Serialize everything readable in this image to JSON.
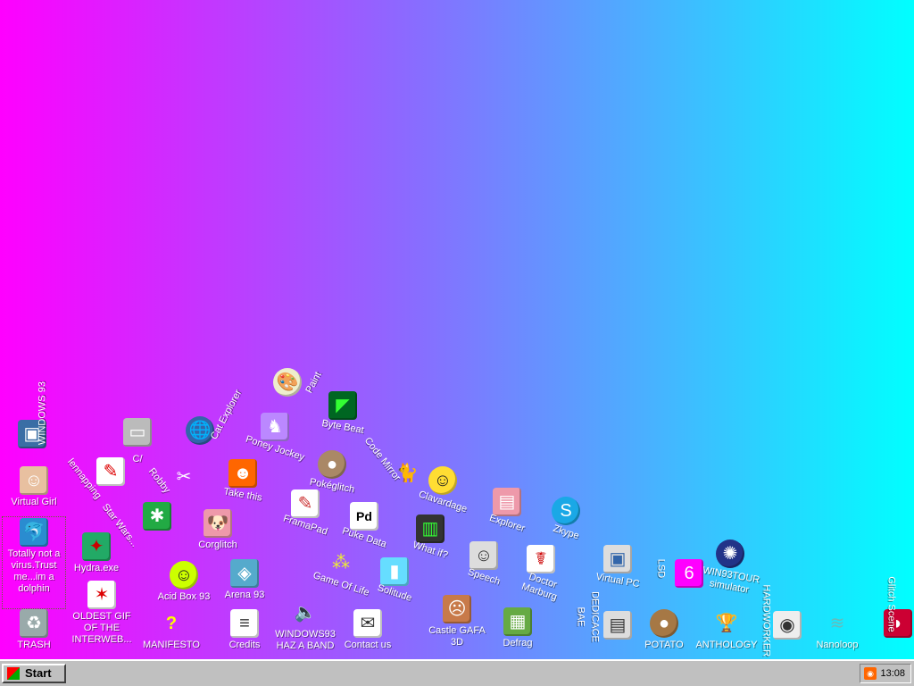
{
  "desktop": {
    "icons": {
      "windows93": "WINDOWS 93",
      "virtual_girl": "Virtual Girl",
      "dolphin": "Totally not a virus.Trust me...im a dolphin",
      "trash": "TRASH",
      "oldest_gif": "OLDEST GIF OF THE INTERWEB...",
      "manifesto": "MANIFESTO",
      "credits": "Credits",
      "windows93_band": "WINDOWS93 HAZ A BAND",
      "contact": "Contact us",
      "castle_gafa": "Castle GAFA 3D",
      "defrag": "Defrag",
      "potato": "POTATO",
      "anthology": "ANTHOLOGY",
      "nanoloop": "Nanoloop",
      "hydra": "Hydra.exe",
      "acid_box": "Acid Box 93",
      "arena": "Arena 93",
      "corglitch": "Corglitch",
      "star_wars": "Star Wars...",
      "lennapping": "lennapping",
      "c": "C/",
      "robby": "Robby",
      "cat_explorer": "Cat Explorer",
      "take_this": "Take this",
      "poney_jockey": "Poney Jockey",
      "paint": "Paint",
      "byte_beat": "Byte Beat",
      "pokeglitch": "Pokéglitch",
      "frama_pad": "FramaPad",
      "puke_data": "Puke Data",
      "code_mirror": "Code Mirror",
      "clavardage": "Clavardage",
      "explorer": "Explorer",
      "zkype": "Zkype",
      "game_of_life": "Game Of Life",
      "solitude": "Solitude",
      "what_if": "What if?",
      "speech": "Speech",
      "doctor_marburg": "Doctor Marburg",
      "virtual_pc": "Virtual PC",
      "lsd": "LSD",
      "windows_tour": "WIN93TOUR simulator",
      "bae": "BAE",
      "dedicace": "DEDICACE",
      "hardworker": "HARDWORKER",
      "glitch_scene": "Glitch Scene"
    }
  },
  "taskbar": {
    "start_label": "Start",
    "clock": "13:08"
  },
  "colors": {
    "gradient_left": "#ff00ff",
    "gradient_mid": "#8a6bff",
    "gradient_right": "#00ffff",
    "taskbar": "#c0c0c0"
  }
}
